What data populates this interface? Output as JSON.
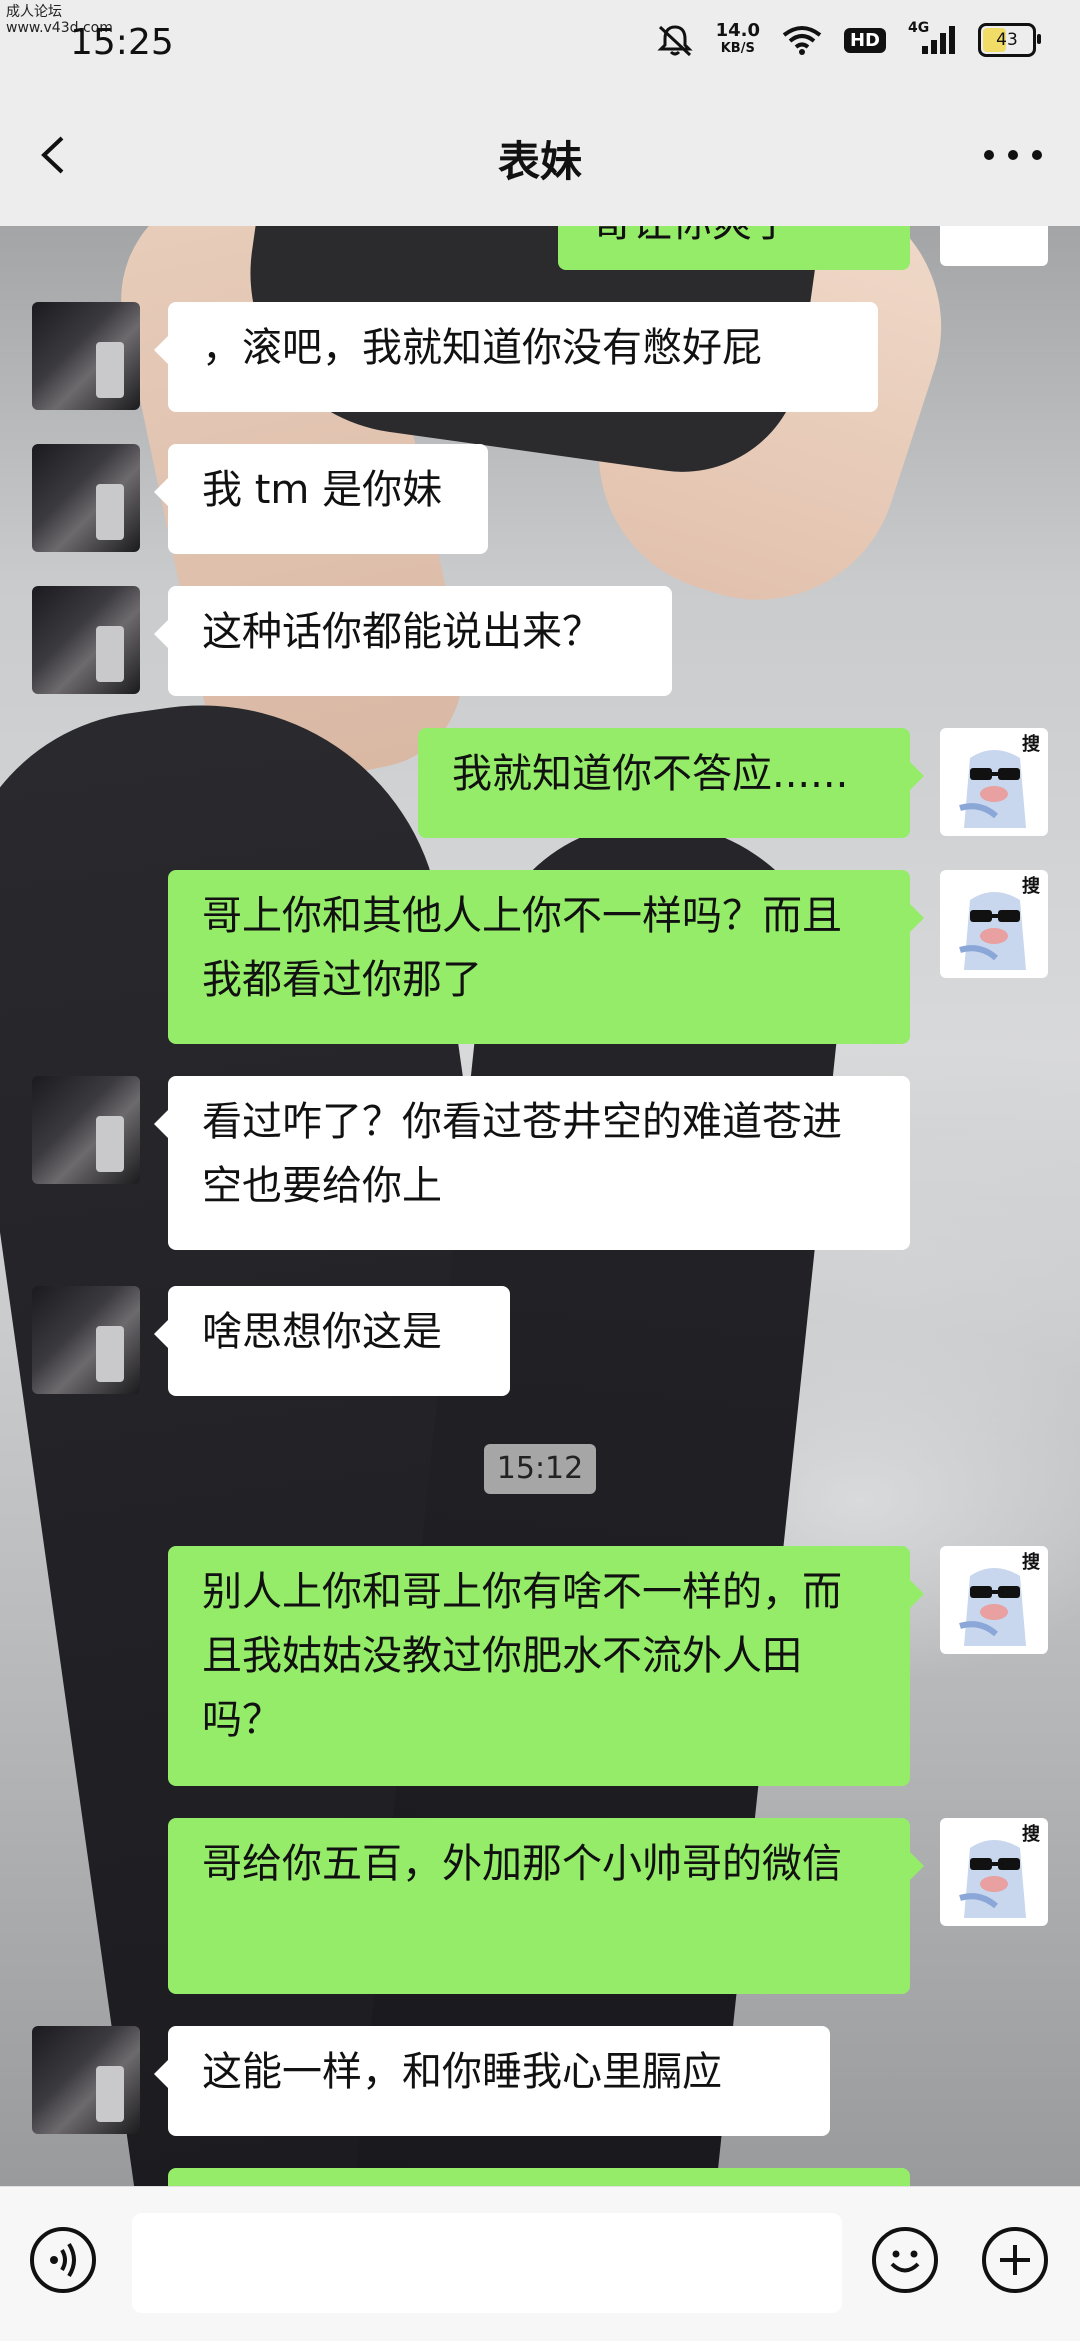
{
  "status_bar": {
    "watermark_line1": "成人论坛",
    "watermark_line2": "www.v43d.com",
    "time": "15:25",
    "net_speed": "14.0",
    "net_speed_unit": "KB/S",
    "hd_badge": "HD",
    "network": "4G",
    "battery": "43"
  },
  "header": {
    "title": "表妹"
  },
  "messages": [
    {
      "from": "me",
      "text": "哥让你爽了"
    },
    {
      "from": "her",
      "text": "，滚吧，我就知道你没有憋好屁"
    },
    {
      "from": "her",
      "text": "我 tm 是你妹"
    },
    {
      "from": "her",
      "text": "这种话你都能说出来？"
    },
    {
      "from": "me",
      "text": "我就知道你不答应......"
    },
    {
      "from": "me",
      "text": "哥上你和其他人上你不一样吗？而且我都看过你那了"
    },
    {
      "from": "her",
      "text": "看过咋了？你看过苍井空的难道苍进空也要给你上"
    },
    {
      "from": "her",
      "text": "啥思想你这是"
    },
    {
      "from": "me",
      "text": "别人上你和哥上你有啥不一样的，而且我姑姑没教过你肥水不流外人田吗？"
    },
    {
      "from": "me",
      "text": "哥给你五百，外加那个小帅哥的微信"
    },
    {
      "from": "her",
      "text": "这能一样，和你睡我心里膈应"
    }
  ],
  "timestamp": "15:12",
  "sticker_label": "搜",
  "input": {
    "placeholder": ""
  },
  "colors": {
    "bubble_out": "#95ec69",
    "bubble_in": "#ffffff",
    "bar": "#ededed"
  }
}
